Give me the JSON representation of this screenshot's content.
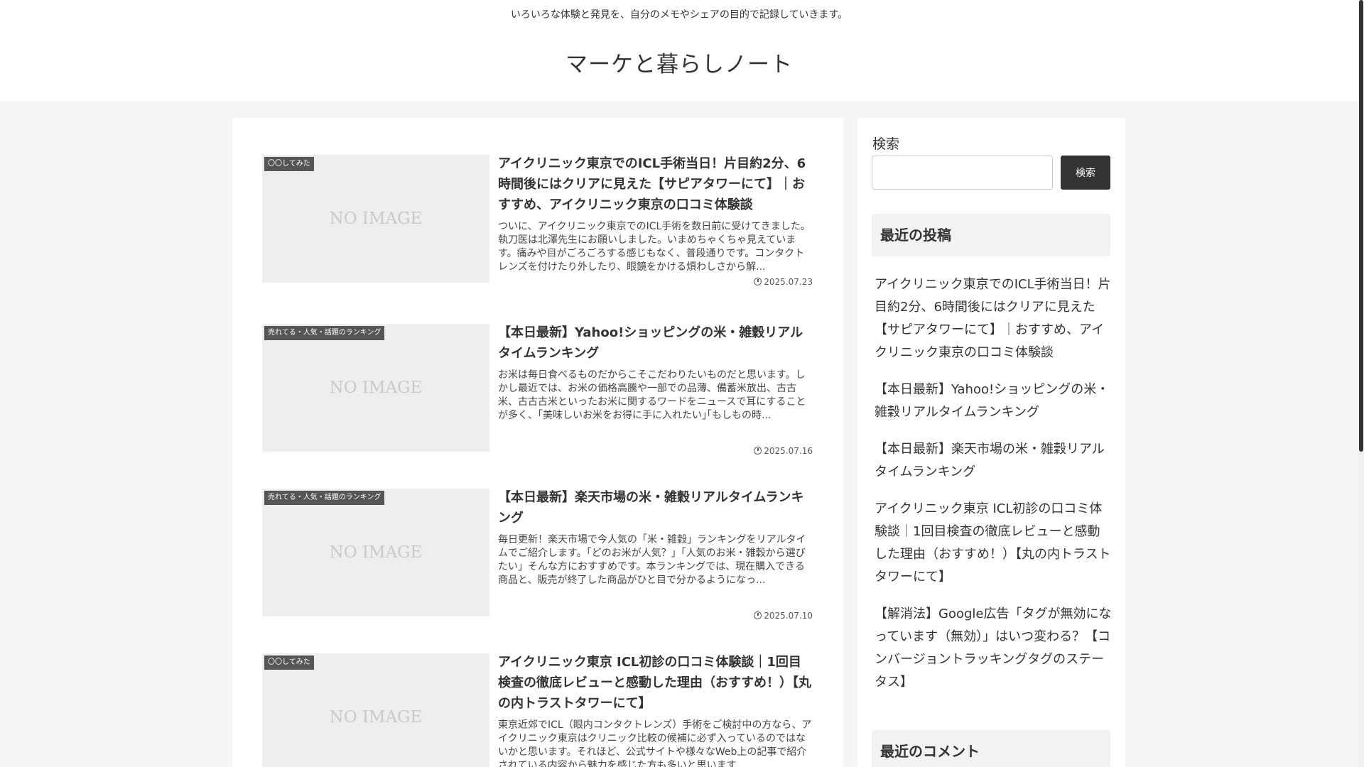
{
  "header": {
    "tagline": "いろいろな体験と発見を、自分のメモやシェアの目的で記録していきます。",
    "site_title": "マーケと暮らしノート"
  },
  "posts": [
    {
      "category": "〇〇してみた",
      "thumb_text": "NO IMAGE",
      "title": "アイクリニック東京でのICL手術当日！片目約2分、6時間後にはクリアに見えた【サピアタワーにて】｜おすすめ、アイクリニック東京の口コミ体験談",
      "snippet": "ついに、アイクリニック東京でのICL手術を数日前に受けてきました。執刀医は北澤先生にお願いしました。いまめちゃくちゃ見えています。痛みや目がごろごろする感じもなく、普段通りです。コンタクトレンズを付けたり外したり、眼鏡をかける煩わしさから解...",
      "date": "2025.07.23"
    },
    {
      "category": "売れてる・人気・話題のランキング",
      "thumb_text": "NO IMAGE",
      "title": "【本日最新】Yahoo!ショッピングの米・雑穀リアルタイムランキング",
      "snippet": "お米は毎日食べるものだからこそこだわりたいものだと思います。しかし最近では、お米の価格高騰や一部での品薄、備蓄米放出、古古米、古古古米といったお米に関するワードをニュースで耳にすることが多く、｢美味しいお米をお得に手に入れたい｣｢もしもの時...",
      "date": "2025.07.16"
    },
    {
      "category": "売れてる・人気・話題のランキング",
      "thumb_text": "NO IMAGE",
      "title": "【本日最新】楽天市場の米・雑穀リアルタイムランキング",
      "snippet": "毎日更新！楽天市場で今人気の「米・雑穀」ランキングをリアルタイムでご紹介します。「どのお米が人気？」「人気のお米・雑穀から選びたい」そんな方におすすめです。本ランキングでは、現在購入できる商品と、販売が終了した商品がひと目で分かるようになっ...",
      "date": "2025.07.10"
    },
    {
      "category": "〇〇してみた",
      "thumb_text": "NO IMAGE",
      "title": "アイクリニック東京 ICL初診の口コミ体験談｜1回目検査の徹底レビューと感動した理由（おすすめ！）【丸の内トラストタワーにて】",
      "snippet": "東京近郊でICL（眼内コンタクトレンズ）手術をご検討中の方なら、アイクリニック東京はクリニック比較の候補に必ず入っているのではないかと思います。それほど、公式サイトや様々なWeb上の記事で紹介されている内容から魅力を感じた方も多いと思います...",
      "date": ""
    }
  ],
  "sidebar": {
    "search_label": "検索",
    "search_value": "",
    "search_button": "検索",
    "recent_posts_heading": "最近の投稿",
    "recent_posts": [
      "アイクリニック東京でのICL手術当日！片目約2分、6時間後にはクリアに見えた【サピアタワーにて】｜おすすめ、アイクリニック東京の口コミ体験談",
      "【本日最新】Yahoo!ショッピングの米・雑穀リアルタイムランキング",
      "【本日最新】楽天市場の米・雑穀リアルタイムランキング",
      "アイクリニック東京 ICL初診の口コミ体験談｜1回目検査の徹底レビューと感動した理由（おすすめ！）【丸の内トラストタワーにて】",
      "【解消法】Google広告「タグが無効になっています（無効）」はいつ変わる？【コンバージョントラッキングタグのステータス】"
    ],
    "recent_comments_heading": "最近のコメント"
  },
  "icons": {
    "date": "clock-icon"
  }
}
